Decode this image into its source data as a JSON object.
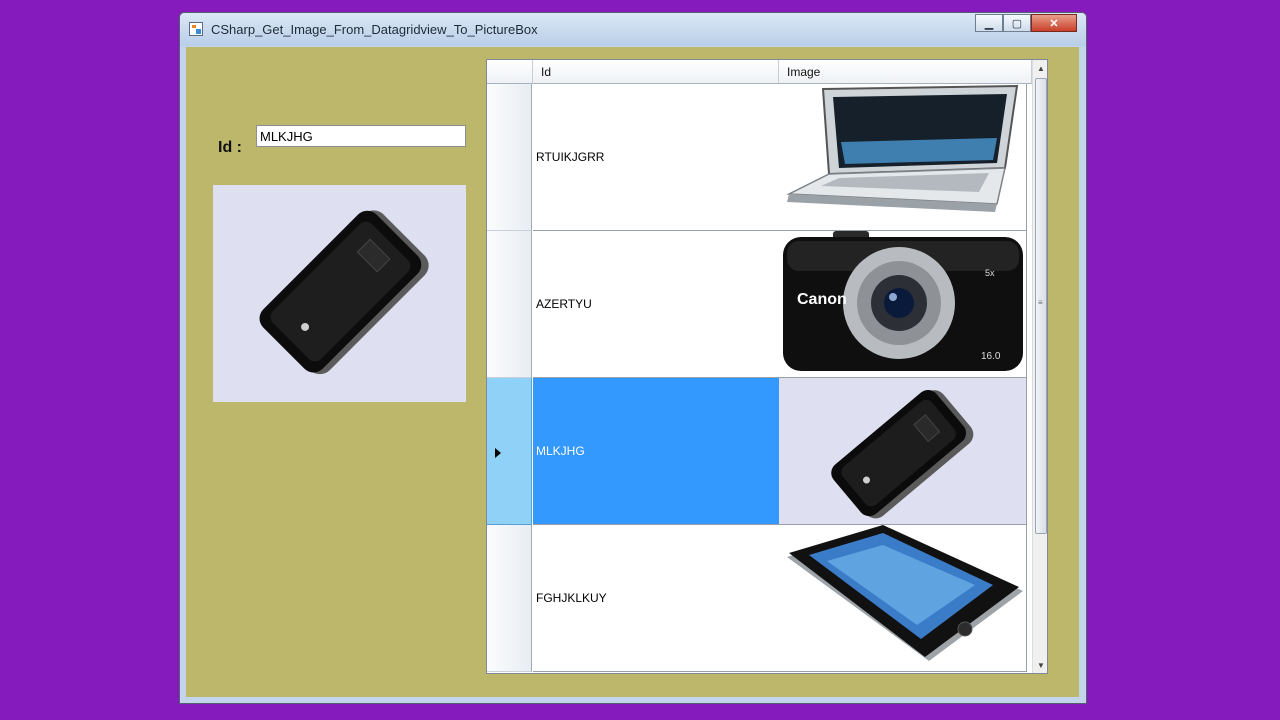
{
  "window": {
    "title": "CSharp_Get_Image_From_Datagridview_To_PictureBox",
    "minimize_icon": "minimize-icon",
    "maximize_icon": "maximize-icon",
    "close_icon": "close-icon"
  },
  "form": {
    "id_label": "Id :",
    "id_value": "MLKJHG",
    "picture_icon": "router-image-icon"
  },
  "grid": {
    "columns": [
      "Id",
      "Image"
    ],
    "rows": [
      {
        "id": "RTUIKJGRR",
        "image": "laptop-image-icon"
      },
      {
        "id": "AZERTYU",
        "image": "camera-image-icon",
        "brand": "Canon",
        "zoom": "5x",
        "mp": "16.0"
      },
      {
        "id": "MLKJHG",
        "image": "router-image-icon",
        "selected": true
      },
      {
        "id": "FGHJKLKUY",
        "image": "smartphone-image-icon"
      }
    ]
  },
  "colors": {
    "desktop": "#861bbd",
    "form_back": "#bdb76b",
    "selection": "#3399ff"
  }
}
